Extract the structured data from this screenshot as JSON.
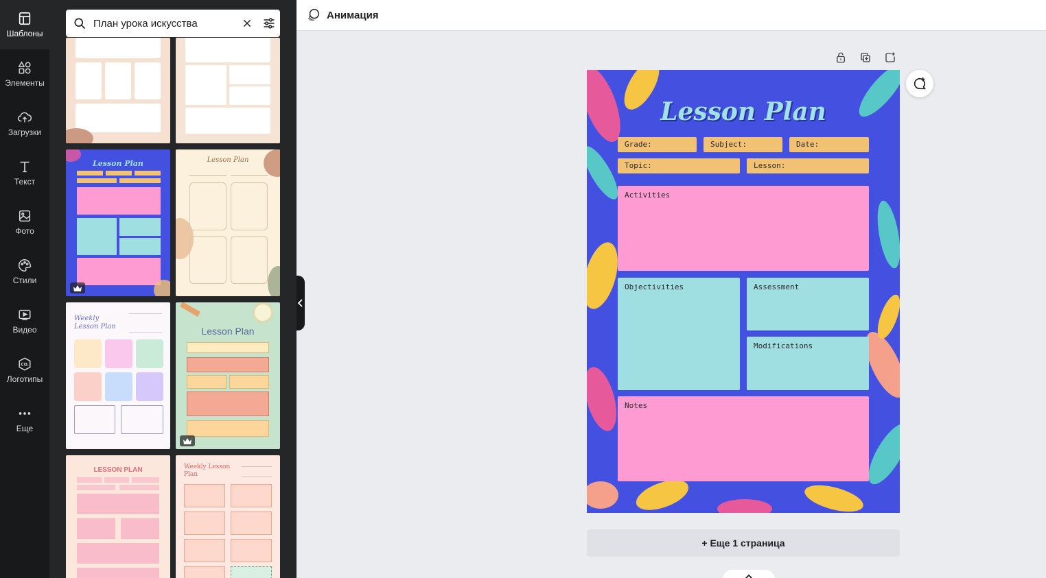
{
  "sidebar": {
    "items": [
      {
        "label": "Шаблоны",
        "icon": "templates-icon"
      },
      {
        "label": "Элементы",
        "icon": "elements-icon"
      },
      {
        "label": "Загрузки",
        "icon": "upload-icon"
      },
      {
        "label": "Текст",
        "icon": "text-icon"
      },
      {
        "label": "Фото",
        "icon": "photo-icon"
      },
      {
        "label": "Стили",
        "icon": "palette-icon"
      },
      {
        "label": "Видео",
        "icon": "video-icon"
      },
      {
        "label": "Логотипы",
        "icon": "logo-icon"
      },
      {
        "label": "Еще",
        "icon": "more-icon"
      }
    ]
  },
  "search": {
    "value": "План урока искусства"
  },
  "topbar": {
    "animation_label": "Анимация"
  },
  "design": {
    "title": "Lesson Plan",
    "fields": {
      "grade": "Grade:",
      "subject": "Subject:",
      "date": "Date:",
      "topic": "Topic:",
      "lesson": "Lesson:"
    },
    "sections": {
      "activities": "Activities",
      "objectivities": "Objectivities",
      "assessment": "Assessment",
      "modifications": "Modifications",
      "notes": "Notes"
    },
    "colors": {
      "background": "#4451e0",
      "field": "#f2c274",
      "pink": "#fe9bd2",
      "teal": "#9fdfe2",
      "title": "#9fe3e6"
    }
  },
  "templates": {
    "thumbs": [
      {
        "title": ""
      },
      {
        "title": ""
      },
      {
        "title": "Lesson Plan"
      },
      {
        "title": "Lesson Plan"
      },
      {
        "title": "Weekly Lesson Plan"
      },
      {
        "title": "Lesson Plan"
      },
      {
        "title": "LESSON PLAN"
      },
      {
        "title": "Weekly Lesson Plan"
      }
    ]
  },
  "canvas": {
    "add_page_label": "+ Еще 1 страница"
  }
}
